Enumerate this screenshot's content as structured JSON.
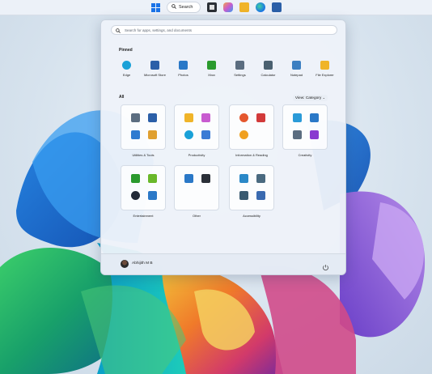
{
  "taskbar": {
    "search_label": "Search",
    "icons": [
      "windows-icon",
      "search-icon",
      "task-view-icon",
      "copilot-icon",
      "file-explorer-icon",
      "edge-icon",
      "store-icon"
    ]
  },
  "start_menu": {
    "search_placeholder": "Search for apps, settings, and documents",
    "pinned_title": "Pinned",
    "pinned": [
      {
        "label": "Edge",
        "icon": "edge-icon",
        "color": "#1aa1d8"
      },
      {
        "label": "Microsoft Store",
        "icon": "store-icon",
        "color": "#2b5fa8"
      },
      {
        "label": "Photos",
        "icon": "photos-icon",
        "color": "#2a78c7"
      },
      {
        "label": "Xbox",
        "icon": "xbox-icon",
        "color": "#2a9a2e"
      },
      {
        "label": "Settings",
        "icon": "gear-icon",
        "color": "#5b6d80"
      },
      {
        "label": "Calculator",
        "icon": "calculator-icon",
        "color": "#4a6070"
      },
      {
        "label": "Notepad",
        "icon": "notepad-icon",
        "color": "#3c7fc1"
      },
      {
        "label": "File Explorer",
        "icon": "folder-icon",
        "color": "#f0b429"
      }
    ],
    "all_title": "All",
    "view_label": "View: Category",
    "folders": [
      {
        "label": "Utilities & Tools",
        "icons": [
          "gear-icon",
          "store-icon",
          "people-icon",
          "apps-icon"
        ],
        "colors": [
          "#5b6d80",
          "#2b5fa8",
          "#2f7bd0",
          "#e0a030"
        ]
      },
      {
        "label": "Productivity",
        "icons": [
          "folder-icon",
          "copilot-icon",
          "edge-icon",
          "apps-icon"
        ],
        "colors": [
          "#f0b429",
          "#c85bd0",
          "#1aa1d8",
          "#3a7bd5"
        ]
      },
      {
        "label": "Information & Reading",
        "icons": [
          "maps-icon",
          "news-icon",
          "weather-icon"
        ],
        "colors": [
          "#e4572e",
          "#d23a3a",
          "#f0a020"
        ]
      },
      {
        "label": "Creativity",
        "icons": [
          "paint-icon",
          "photos-icon",
          "camera-icon",
          "clipchamp-icon"
        ],
        "colors": [
          "#2a9ad8",
          "#2a78c7",
          "#5b6d80",
          "#8a3ad0"
        ]
      },
      {
        "label": "Entertainment",
        "icons": [
          "xbox-icon",
          "game-icon",
          "media-player-icon",
          "movies-icon"
        ],
        "colors": [
          "#2a9a2e",
          "#6ab82a",
          "#222a36",
          "#2a78c7"
        ]
      },
      {
        "label": "Other",
        "icons": [
          "snipping-icon",
          "terminal-icon"
        ],
        "colors": [
          "#2a78c7",
          "#2a2f38"
        ]
      },
      {
        "label": "Accessibility",
        "icons": [
          "keyboard-icon",
          "magnifier-icon",
          "narrator-icon",
          "speech-icon"
        ],
        "colors": [
          "#2a88c7",
          "#4a6a80",
          "#3a5a70",
          "#3a6ab0"
        ]
      }
    ],
    "user_name": "Abhijith M B",
    "power_icon": "power-icon"
  }
}
